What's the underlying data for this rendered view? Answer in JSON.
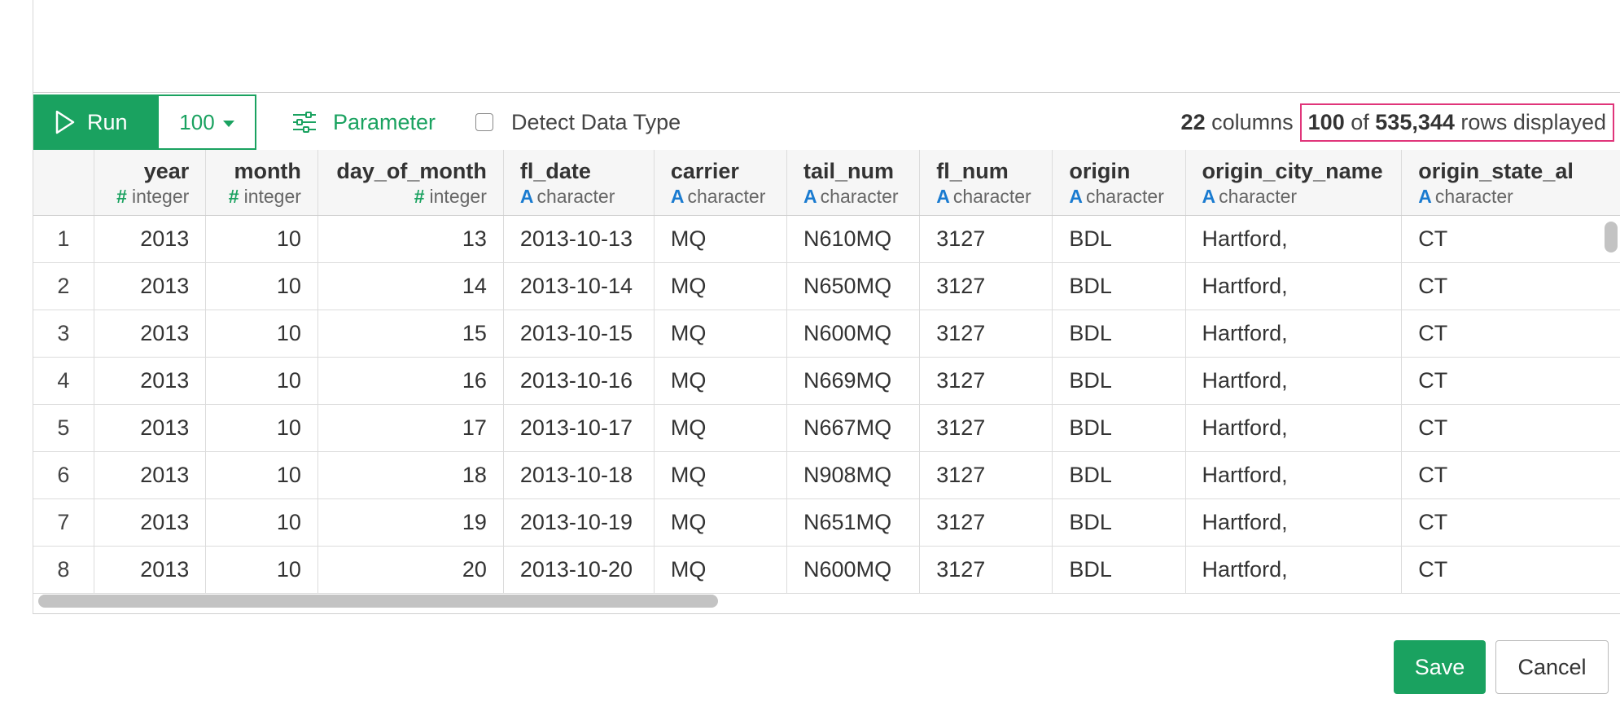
{
  "toolbar": {
    "run_label": "Run",
    "limit_value": "100",
    "parameter_label": "Parameter",
    "detect_label": "Detect Data Type",
    "columns_count": "22",
    "columns_label": "columns",
    "rows_shown": "100",
    "rows_of": "of",
    "rows_total": "535,344",
    "rows_label": "rows displayed"
  },
  "table": {
    "columns": [
      {
        "name": "year",
        "type": "integer",
        "kind": "int"
      },
      {
        "name": "month",
        "type": "integer",
        "kind": "int"
      },
      {
        "name": "day_of_month",
        "type": "integer",
        "kind": "int"
      },
      {
        "name": "fl_date",
        "type": "character",
        "kind": "chr"
      },
      {
        "name": "carrier",
        "type": "character",
        "kind": "chr"
      },
      {
        "name": "tail_num",
        "type": "character",
        "kind": "chr"
      },
      {
        "name": "fl_num",
        "type": "character",
        "kind": "chr"
      },
      {
        "name": "origin",
        "type": "character",
        "kind": "chr"
      },
      {
        "name": "origin_city_name",
        "type": "character",
        "kind": "chr"
      },
      {
        "name": "origin_state_al",
        "type": "character",
        "kind": "chr"
      }
    ],
    "rows": [
      {
        "n": "1",
        "cells": [
          "2013",
          "10",
          "13",
          "2013-10-13",
          "MQ",
          "N610MQ",
          "3127",
          "BDL",
          "Hartford,",
          "CT"
        ]
      },
      {
        "n": "2",
        "cells": [
          "2013",
          "10",
          "14",
          "2013-10-14",
          "MQ",
          "N650MQ",
          "3127",
          "BDL",
          "Hartford,",
          "CT"
        ]
      },
      {
        "n": "3",
        "cells": [
          "2013",
          "10",
          "15",
          "2013-10-15",
          "MQ",
          "N600MQ",
          "3127",
          "BDL",
          "Hartford,",
          "CT"
        ]
      },
      {
        "n": "4",
        "cells": [
          "2013",
          "10",
          "16",
          "2013-10-16",
          "MQ",
          "N669MQ",
          "3127",
          "BDL",
          "Hartford,",
          "CT"
        ]
      },
      {
        "n": "5",
        "cells": [
          "2013",
          "10",
          "17",
          "2013-10-17",
          "MQ",
          "N667MQ",
          "3127",
          "BDL",
          "Hartford,",
          "CT"
        ]
      },
      {
        "n": "6",
        "cells": [
          "2013",
          "10",
          "18",
          "2013-10-18",
          "MQ",
          "N908MQ",
          "3127",
          "BDL",
          "Hartford,",
          "CT"
        ]
      },
      {
        "n": "7",
        "cells": [
          "2013",
          "10",
          "19",
          "2013-10-19",
          "MQ",
          "N651MQ",
          "3127",
          "BDL",
          "Hartford,",
          "CT"
        ]
      },
      {
        "n": "8",
        "cells": [
          "2013",
          "10",
          "20",
          "2013-10-20",
          "MQ",
          "N600MQ",
          "3127",
          "BDL",
          "Hartford,",
          "CT"
        ]
      }
    ]
  },
  "footer": {
    "save_label": "Save",
    "cancel_label": "Cancel"
  },
  "icons": {
    "int_type_glyph": "#",
    "chr_type_glyph": "A"
  },
  "colors": {
    "accent": "#1aa260",
    "highlight_border": "#e0357a",
    "character_type": "#1a7bd0"
  }
}
